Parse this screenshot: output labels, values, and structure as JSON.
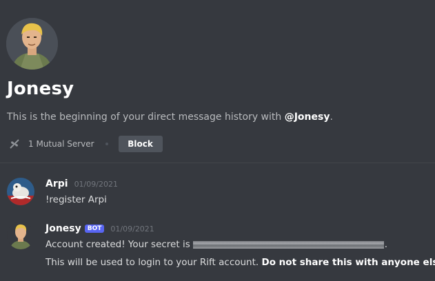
{
  "profile": {
    "name": "Jonesy",
    "intro_text": "This is the beginning of your direct message history with ",
    "mention": "@Jonesy",
    "intro_end": ".",
    "mutual_servers": "1 Mutual Server",
    "block_label": "Block"
  },
  "messages": [
    {
      "username": "Arpi",
      "timestamp": "01/09/2021",
      "lines": [
        "!register Arpi"
      ]
    },
    {
      "username": "Jonesy",
      "badge": "BOT",
      "timestamp": "01/09/2021",
      "line1_prefix": "Account created! Your secret is",
      "line1_suffix": ".",
      "line2_text": "This will be used to login to your Rift account. ",
      "line2_bold": "Do not share this with anyone else!"
    }
  ],
  "colors": {
    "background": "#36393f",
    "bot_badge": "#5865f2",
    "button": "#4f545c"
  }
}
